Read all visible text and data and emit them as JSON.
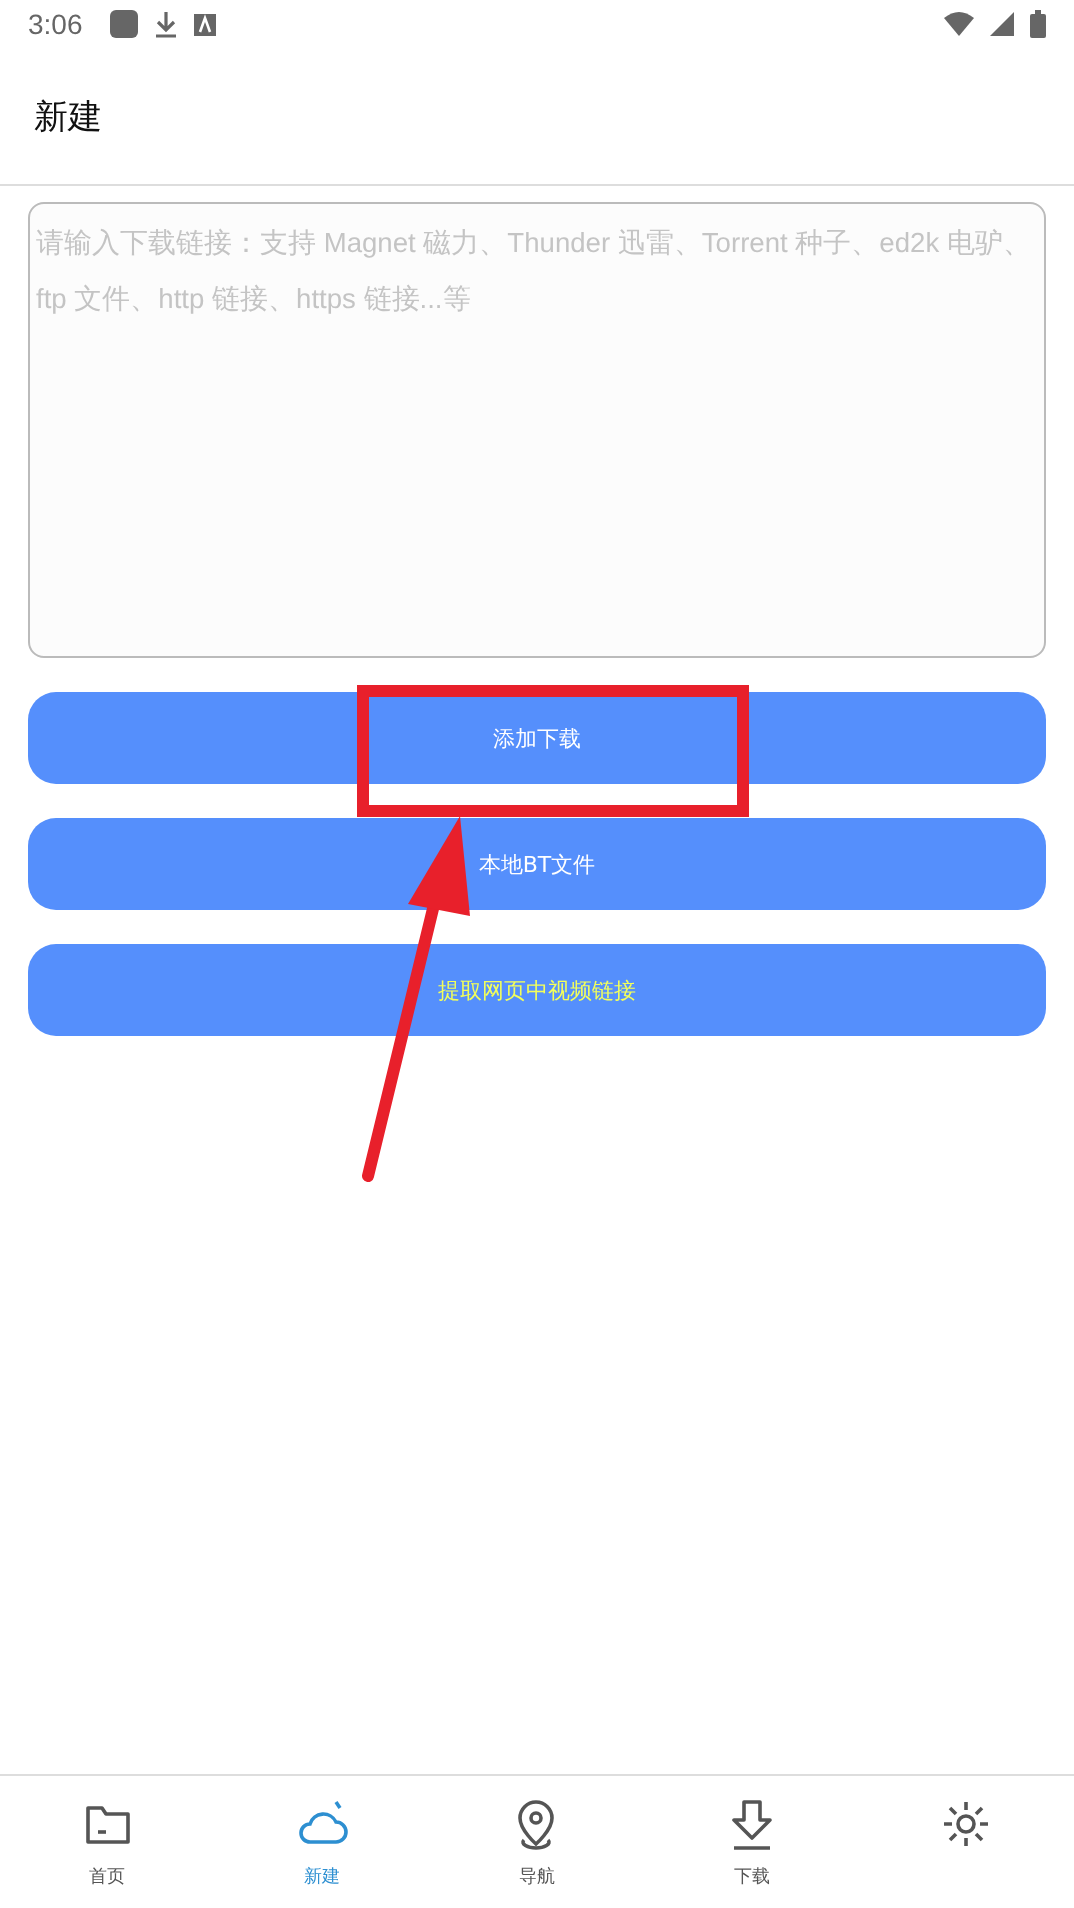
{
  "status_bar": {
    "time": "3:06"
  },
  "header": {
    "title": "新建"
  },
  "link_input": {
    "placeholder": "请输入下载链接：支持 Magnet 磁力、Thunder 迅雷、Torrent 种子、ed2k 电驴、ftp 文件、http 链接、https 链接...等"
  },
  "buttons": [
    {
      "label": "添加下载",
      "highlight": false
    },
    {
      "label": "本地BT文件",
      "highlight": false
    },
    {
      "label": "提取网页中视频链接",
      "highlight": true
    }
  ],
  "tab_bar": [
    {
      "kind": "folder",
      "label": "首页",
      "selected": false
    },
    {
      "kind": "cloud",
      "label": "新建",
      "selected": true
    },
    {
      "kind": "pin",
      "label": "导航",
      "selected": false
    },
    {
      "kind": "download",
      "label": "下载",
      "selected": false
    },
    {
      "kind": "gear",
      "selected": false
    }
  ]
}
